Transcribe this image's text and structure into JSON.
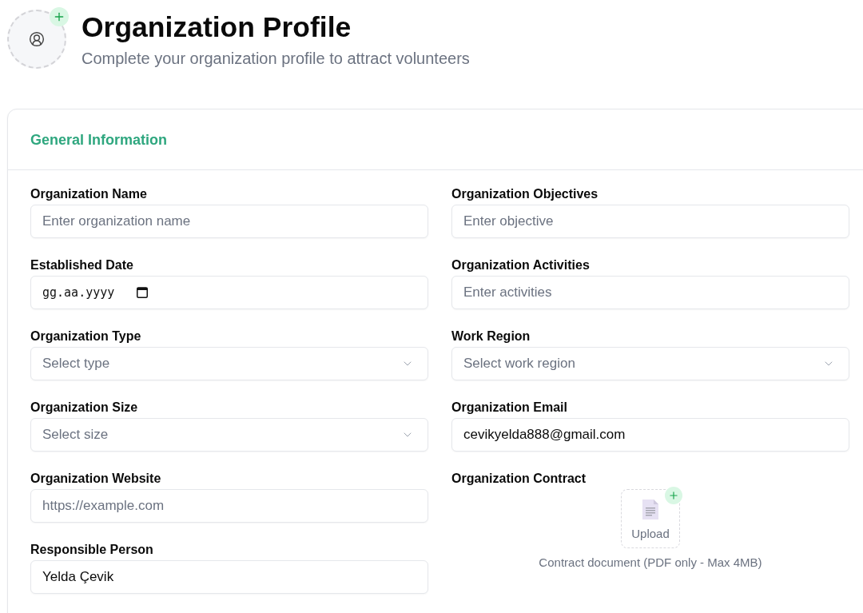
{
  "header": {
    "title": "Organization Profile",
    "subtitle": "Complete your organization profile to attract volunteers"
  },
  "card": {
    "title": "General Information",
    "fields": [
      {
        "kind": "text",
        "label": "Organization Name",
        "placeholder": "Enter organization name"
      },
      {
        "kind": "text",
        "label": "Organization Objectives",
        "placeholder": "Enter objective"
      },
      {
        "kind": "date",
        "label": "Established Date",
        "placeholder": "gg.aa.yyyy"
      },
      {
        "kind": "text",
        "label": "Organization Activities",
        "placeholder": "Enter activities"
      },
      {
        "kind": "select",
        "label": "Organization Type",
        "placeholder": "Select type"
      },
      {
        "kind": "select",
        "label": "Work Region",
        "placeholder": "Select work region"
      },
      {
        "kind": "select",
        "label": "Organization Size",
        "placeholder": "Select size"
      },
      {
        "kind": "text",
        "label": "Organization Email",
        "value": "cevikyelda888@gmail.com"
      },
      {
        "kind": "text",
        "label": "Organization Website",
        "placeholder": "https://example.com"
      },
      {
        "kind": "upload",
        "label": "Organization Contract",
        "button": "Upload",
        "caption": "Contract document (PDF only - Max 4MB)"
      },
      {
        "kind": "text",
        "label": "Responsible Person",
        "value": "Yelda Çevik"
      }
    ]
  }
}
